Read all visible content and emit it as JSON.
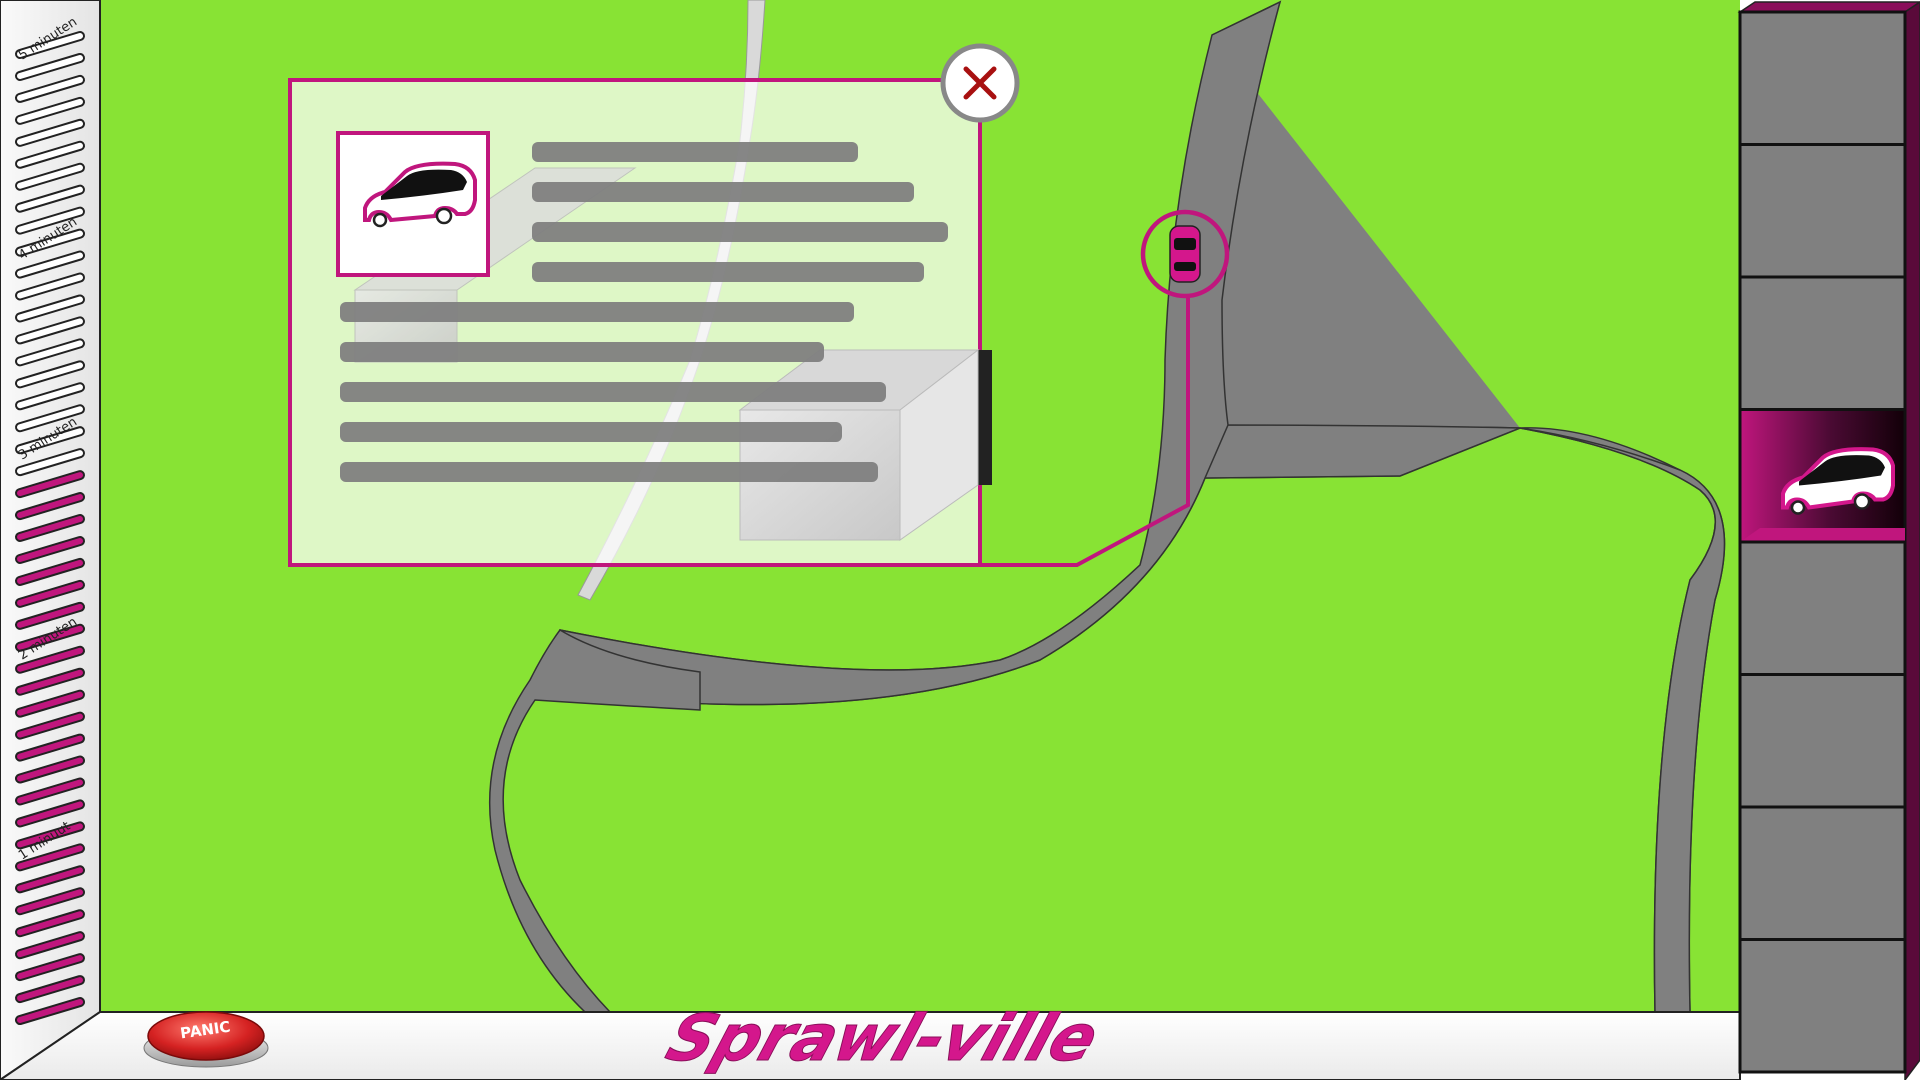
{
  "app": {
    "title": "Sprawl-ville",
    "accent_color": "#d4178c",
    "map_color": "#88e334",
    "road_color": "#808080"
  },
  "timer": {
    "labels": [
      "5 minuten",
      "4 minuten",
      "3 minuten",
      "2 minuten",
      "1 minuut"
    ],
    "total_segments": 45,
    "filled_segments": 25,
    "filled_color": "#c0167d",
    "empty_color": "#ffffff"
  },
  "panic_button": {
    "label": "PANIC",
    "color": "#d52222",
    "icon": "panic-button-icon"
  },
  "info_popup": {
    "icon": "car-icon",
    "close_icon": "close-icon",
    "text_lines_short": 4,
    "text_lines_long": 5
  },
  "map_marker": {
    "icon": "car-icon",
    "color": "#d4178c"
  },
  "vehicle_panel": {
    "slot_count": 8,
    "selected_index": 3,
    "selected_icon": "car-icon"
  }
}
